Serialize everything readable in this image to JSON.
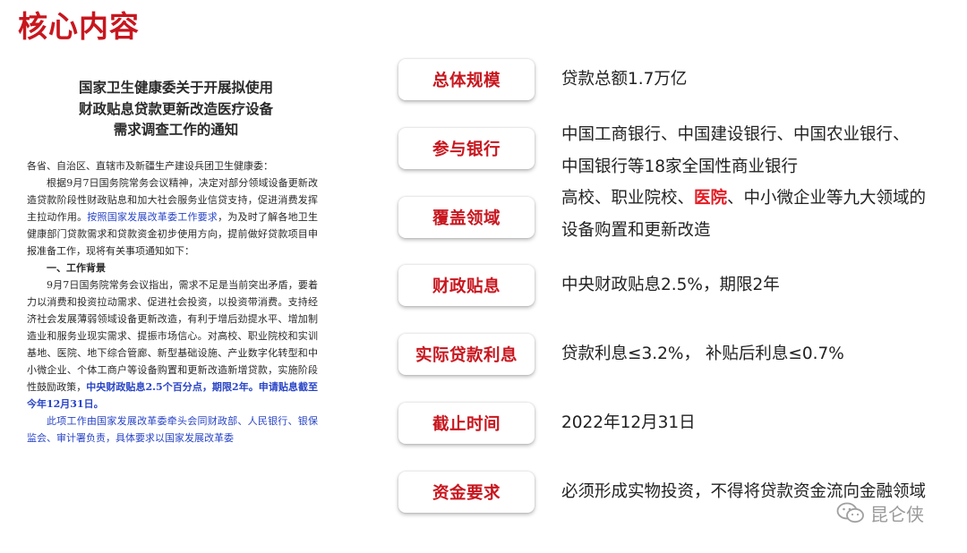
{
  "header": {
    "title": "核心内容"
  },
  "document": {
    "title_lines": [
      "国家卫生健康委关于开展拟使用",
      "财政贴息贷款更新改造医疗设备",
      "需求调查工作的通知"
    ],
    "salutation": "各省、自治区、直辖市及新疆生产建设兵团卫生健康委：",
    "para1_a": "根据9月7日国务院常务会议精神，决定对部分领域设备更新改造贷款阶段性财政贴息和加大社会服务业信贷支持，促进消费发挥主拉动作用。",
    "para1_link": "按照国家发展改革委工作要求",
    "para1_b": "，为及时了解各地卫生健康部门贷款需求和贷款资金初步使用方向，提前做好贷款项目申报准备工作，现将有关事项通知如下：",
    "section1": "一、工作背景",
    "para2_a": "9月7日国务院常务会议指出，需求不足是当前突出矛盾，要着力以消费和投资拉动需求、促进社会投资，以投资带消费。支持经济社会发展薄弱领域设备更新改造，有利于增后劲提水平、增加制造业和服务业现实需求、提振市场信心。对高校、职业院校和实训基地、医院、地下综合管廊、新型基础设施、产业数字化转型和中小微企业、个体工商户等设备购置和更新改造新增贷款，实施阶段性鼓励政策，",
    "para2_hl": "中央财政贴息2.5个百分点，期限2年。申请贴息截至今年12月31日。",
    "para3_a": "此项工作由国家发展改革委牵头会同财政部、人民银行、银保监会、审计署负责，具体要求以国家发展改革委"
  },
  "rows": [
    {
      "label": "总体规模",
      "value": "贷款总额1.7万亿"
    },
    {
      "label": "参与银行",
      "value_line1": "中国工商银行、中国建设银行、中国农业银行、",
      "value_line2": "中国银行等18家全国性商业银行"
    },
    {
      "label": "覆盖领域",
      "value_pre": "高校、职业院校、",
      "value_hl": "医院",
      "value_post": "、中小微企业等九大领域的",
      "value_line2": "设备购置和更新改造"
    },
    {
      "label": "财政贴息",
      "value": "中央财政贴息2.5%，期限2年"
    },
    {
      "label": "实际贷款利息",
      "value": "贷款利息≤3.2%， 补贴后利息≤0.7%"
    },
    {
      "label": "截止时间",
      "value": "2022年12月31日"
    },
    {
      "label": "资金要求",
      "value": "必须形成实物投资，不得将贷款资金流向金融领域"
    }
  ],
  "watermark": {
    "text": "昆仑侠",
    "icon": "wechat-icon"
  },
  "colors": {
    "accent": "#c8161e",
    "highlight": "#e31b23",
    "doc_link": "#2a45c7"
  }
}
